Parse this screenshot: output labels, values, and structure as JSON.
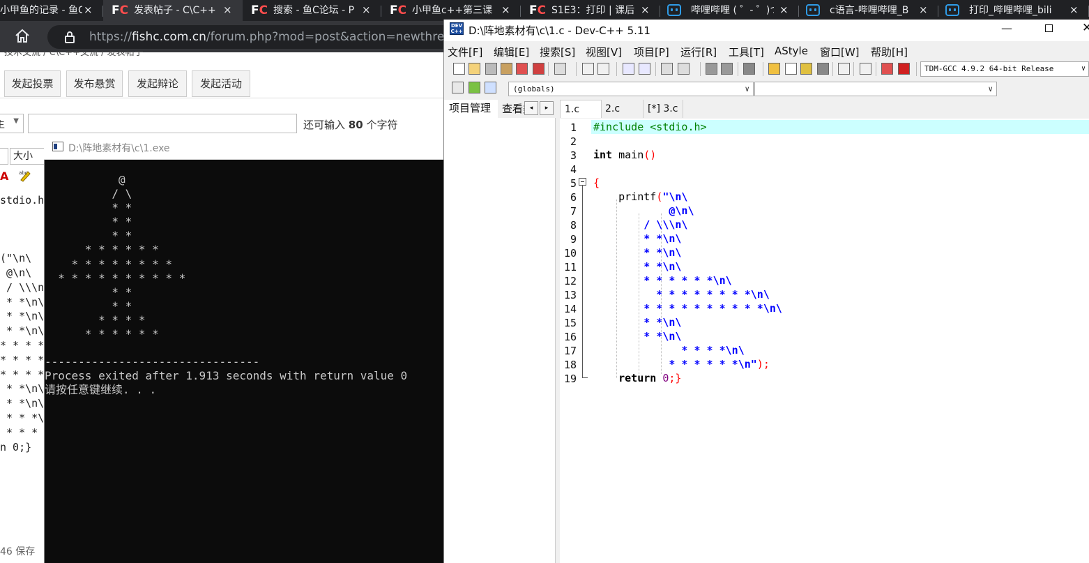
{
  "browser": {
    "tabs": [
      {
        "favicon": "fc-icon",
        "title": "小甲鱼的记录 - 鱼C",
        "active": false
      },
      {
        "favicon": "fc-icon",
        "title": "发表帖子 - C\\C++",
        "active": true
      },
      {
        "favicon": "fc-icon",
        "title": "搜索 - 鱼C论坛 - P",
        "active": false
      },
      {
        "favicon": "fc-icon",
        "title": "小甲鱼c++第三课",
        "active": false
      },
      {
        "favicon": "fc-icon",
        "title": "S1E3：打印 | 课后",
        "active": false
      },
      {
        "favicon": "bilibili-icon",
        "title": "哔哩哔哩 ( ゜- ゜)つ",
        "active": false
      },
      {
        "favicon": "bilibili-icon",
        "title": "c语言-哔哩哔哩_B",
        "active": false
      },
      {
        "favicon": "bilibili-icon",
        "title": "打印_哔哩哔哩_bili",
        "active": false
      }
    ],
    "close_glyph": "×",
    "url_prefix": "https://",
    "url_host": "fishc.com.cn",
    "url_path": "/forum.php?mod=post&action=newthread&fid"
  },
  "forum": {
    "breadcrumb": "技术交流  /  C\\C++交流  /  发表帖子",
    "post_type_buttons": [
      "发起投票",
      "发布悬赏",
      "发起辩论",
      "发起活动"
    ],
    "select_value": "主",
    "char_counter_prefix": "还可输入",
    "char_counter_value": "80",
    "char_counter_suffix": "个字符",
    "font_size_label": "大小",
    "editor_lines": [
      "stdio.h>",
      "",
      "",
      "",
      "(\"\\n\\",
      " @\\n\\",
      " / \\\\\\n\\",
      " * *\\n\\",
      " * *\\n\\",
      " * *\\n\\",
      "* * * *\\",
      "* * * *",
      "* * * *",
      " * *\\n\\",
      " * *\\n\\",
      " * * *\\n\\",
      " * * * *\\",
      "n 0;}"
    ],
    "save_status": "46 保存"
  },
  "console": {
    "title": "D:\\阵地素材有\\c\\1.exe",
    "output": "           @\n          / \\\n          * *\n          * *\n          * *\n      * * * * * *\n    * * * * * * * *\n  * * * * * * * * * *\n          * *\n          * *\n        * * * *\n      * * * * * *\n\n--------------------------------\nProcess exited after 1.913 seconds with return value 0\n请按任意键继续. . ."
  },
  "devcpp": {
    "title": "D:\\阵地素材有\\c\\1.c - Dev-C++ 5.11",
    "menus": [
      "文件[F]",
      "编辑[E]",
      "搜索[S]",
      "视图[V]",
      "项目[P]",
      "运行[R]",
      "工具[T]",
      "AStyle",
      "窗口[W]",
      "帮助[H]"
    ],
    "compiler": "TDM-GCC 4.9.2 64-bit Release",
    "scope_combo": "(globals)",
    "symbol_combo": "",
    "left_tabs": [
      "项目管理",
      "查看类"
    ],
    "file_tabs": [
      "1.c",
      "2.c",
      "[*] 3.c"
    ],
    "active_file_tab": "1.c",
    "line_numbers": [
      "1",
      "2",
      "3",
      "4",
      "5",
      "6",
      "7",
      "8",
      "9",
      "10",
      "11",
      "12",
      "13",
      "14",
      "15",
      "16",
      "17",
      "18",
      "19"
    ],
    "code": {
      "l1": "#include <stdio.h>",
      "l3_kw": "int",
      "l3_rest": " main",
      "l3_paren": "()",
      "l5": "{",
      "l6_fn": "    printf",
      "l6_paren": "(",
      "l6_str": "\"\\n\\",
      "l7": "            @\\n\\",
      "l8": "        / \\\\\\n\\",
      "l9": "        * *\\n\\",
      "l10": "        * *\\n\\",
      "l11": "        * *\\n\\",
      "l12": "        * * * * * *\\n\\",
      "l13": "          * * * * * * * *\\n\\",
      "l14": "        * * * * * * * * * *\\n\\",
      "l15": "        * *\\n\\",
      "l16": "        * *\\n\\",
      "l17": "              * * * *\\n\\",
      "l18_str": "            * * * * * *\\n\"",
      "l18_end": ");",
      "l19_kw": "    return",
      "l19_num": " 0",
      "l19_end": ";}"
    }
  },
  "colors": {
    "browser_tabbar": "#202124",
    "browser_active_tab": "#35363a",
    "console_bg": "#0c0c0c",
    "current_line": "#ccffff",
    "string_color": "#0000ff",
    "preprocessor": "#008000",
    "symbol": "#ff0000"
  }
}
